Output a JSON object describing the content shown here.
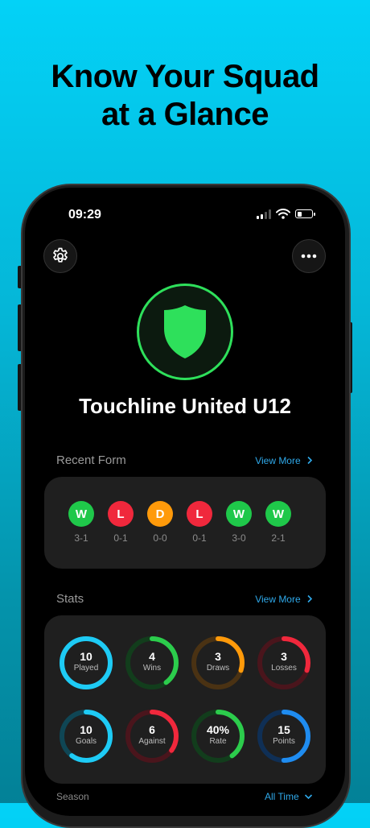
{
  "headline": {
    "line1": "Know Your Squad",
    "line2": "at a Glance"
  },
  "status_bar": {
    "time": "09:29"
  },
  "team": {
    "name": "Touchline United U12",
    "crest_color": "#2ee05b"
  },
  "recent_form": {
    "title": "Recent Form",
    "link": "View More",
    "results": [
      {
        "result": "W",
        "score": "3-1",
        "color": "#1fc84a"
      },
      {
        "result": "L",
        "score": "0-1",
        "color": "#f0283c"
      },
      {
        "result": "D",
        "score": "0-0",
        "color": "#ff9a0a"
      },
      {
        "result": "L",
        "score": "0-1",
        "color": "#f0283c"
      },
      {
        "result": "W",
        "score": "3-0",
        "color": "#1fc84a"
      },
      {
        "result": "W",
        "score": "2-1",
        "color": "#1fc84a"
      }
    ]
  },
  "stats": {
    "title": "Stats",
    "link": "View More",
    "items": [
      {
        "value": "10",
        "label": "Played",
        "fraction": 1.0,
        "color": "#1ecbf5",
        "track": "#0f4655"
      },
      {
        "value": "4",
        "label": "Wins",
        "fraction": 0.4,
        "color": "#2ccc4c",
        "track": "#123d1c"
      },
      {
        "value": "3",
        "label": "Draws",
        "fraction": 0.3,
        "color": "#ff9a0a",
        "track": "#4a3213"
      },
      {
        "value": "3",
        "label": "Losses",
        "fraction": 0.3,
        "color": "#f0283c",
        "track": "#4a151c"
      },
      {
        "value": "10",
        "label": "Goals",
        "fraction": 0.6,
        "color": "#1ecbf5",
        "track": "#0f4655"
      },
      {
        "value": "6",
        "label": "Against",
        "fraction": 0.35,
        "color": "#f0283c",
        "track": "#4a151c"
      },
      {
        "value": "40%",
        "label": "Rate",
        "fraction": 0.4,
        "color": "#2ccc4c",
        "track": "#123d1c"
      },
      {
        "value": "15",
        "label": "Points",
        "fraction": 0.5,
        "color": "#1f8cf0",
        "track": "#0f2f55"
      }
    ]
  },
  "season": {
    "title": "Season",
    "filter": "All Time"
  },
  "icons": {
    "settings": "gear-icon",
    "more": "ellipsis-icon",
    "crest": "shield-icon",
    "link": "chevron-right-icon",
    "filter": "chevron-down-icon"
  }
}
